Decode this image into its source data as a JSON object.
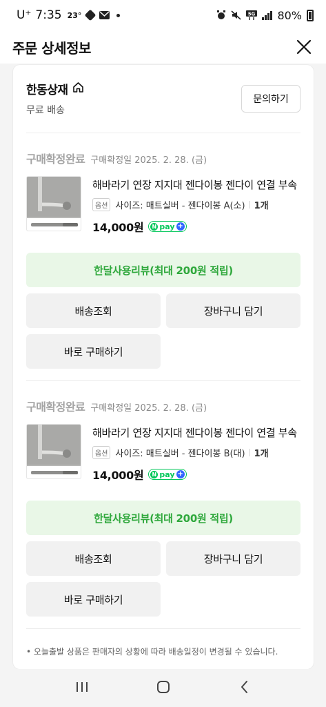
{
  "status_bar": {
    "carrier": "U⁺",
    "time": "7:35",
    "temperature": "23°",
    "battery": "80%",
    "network": "5G"
  },
  "header": {
    "title": "주문 상세정보"
  },
  "seller": {
    "name": "한동상재",
    "shipping": "무료 배송",
    "inquire_label": "문의하기"
  },
  "orders": [
    {
      "status": "구매확정완료",
      "date": "구매확정일 2025. 2. 28. (금)",
      "product_name": "해바라기 연장 지지대 젠다이봉 젠다이 연결 부속",
      "option_badge": "옵션",
      "option": "사이즈: 매트실버 - 젠다이봉 A(소)",
      "quantity": "1개",
      "price": "14,000원",
      "review_label": "한달사용리뷰(최대 200원 적립)",
      "buttons": [
        "배송조회",
        "장바구니 담기",
        "바로 구매하기"
      ]
    },
    {
      "status": "구매확정완료",
      "date": "구매확정일 2025. 2. 28. (금)",
      "product_name": "해바라기 연장 지지대 젠다이봉 젠다이 연결 부속",
      "option_badge": "옵션",
      "option": "사이즈: 매트실버 - 젠다이봉 B(대)",
      "quantity": "1개",
      "price": "14,000원",
      "review_label": "한달사용리뷰(최대 200원 적립)",
      "buttons": [
        "배송조회",
        "장바구니 담기",
        "바로 구매하기"
      ]
    }
  ],
  "npay": {
    "n": "N",
    "text": "pay",
    "plus": "+"
  },
  "notice": "• 오늘출발 상품은 판매자의 상황에 따라 배송일정이 변경될 수 있습니다.",
  "colors": {
    "review_green": "#2fa83c",
    "review_bg": "#e9f7e7",
    "npay_green": "#03c75a",
    "npay_plus_blue": "#3366ff"
  },
  "icons": {
    "close": "close-icon",
    "home": "home-icon",
    "nav_recent": "recent-apps-icon",
    "nav_home": "home-button-icon",
    "nav_back": "back-icon"
  }
}
